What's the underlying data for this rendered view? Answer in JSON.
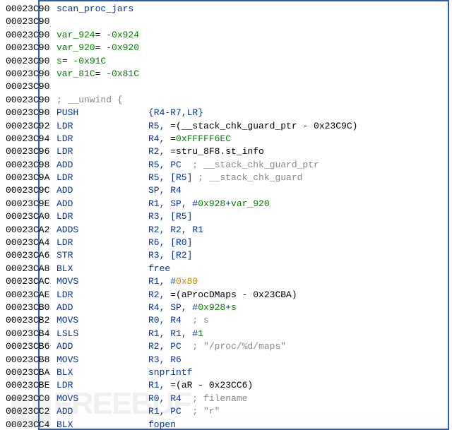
{
  "watermark": "FREEBUF",
  "lines": [
    {
      "addr": "00023C90",
      "segments": [
        {
          "cls": "op-blue col-op",
          "text": "scan_proc_jars"
        }
      ]
    },
    {
      "addr": "00023C90",
      "segments": []
    },
    {
      "addr": "00023C90",
      "segments": [
        {
          "cls": "num-green",
          "text": "var_924"
        },
        {
          "cls": "txt-black",
          "text": "= "
        },
        {
          "cls": "num-green",
          "text": "-0x924"
        }
      ]
    },
    {
      "addr": "00023C90",
      "segments": [
        {
          "cls": "num-green",
          "text": "var_920"
        },
        {
          "cls": "txt-black",
          "text": "= "
        },
        {
          "cls": "num-green",
          "text": "-0x920"
        }
      ]
    },
    {
      "addr": "00023C90",
      "segments": [
        {
          "cls": "num-green",
          "text": "s"
        },
        {
          "cls": "txt-black",
          "text": "= "
        },
        {
          "cls": "num-green",
          "text": "-0x91C"
        }
      ]
    },
    {
      "addr": "00023C90",
      "segments": [
        {
          "cls": "num-green",
          "text": "var_81C"
        },
        {
          "cls": "txt-black",
          "text": "= "
        },
        {
          "cls": "num-green",
          "text": "-0x81C"
        }
      ]
    },
    {
      "addr": "00023C90",
      "segments": []
    },
    {
      "addr": "00023C90",
      "segments": [
        {
          "cls": "txt-gray",
          "text": "; __unwind {"
        }
      ]
    },
    {
      "addr": "00023C90",
      "mnemonic": "PUSH",
      "mnemonicCls": "mn-blue",
      "segments": [
        {
          "cls": "op-blue",
          "text": "{R4-R7,LR}"
        }
      ]
    },
    {
      "addr": "00023C92",
      "mnemonic": "LDR",
      "mnemonicCls": "mn-blue",
      "segments": [
        {
          "cls": "op-blue",
          "text": "R5, "
        },
        {
          "cls": "txt-black",
          "text": "=(__stack_chk_guard_ptr - 0x23C9C)"
        }
      ]
    },
    {
      "addr": "00023C94",
      "mnemonic": "LDR",
      "mnemonicCls": "mn-blue",
      "segments": [
        {
          "cls": "op-blue",
          "text": "R4, "
        },
        {
          "cls": "txt-black",
          "text": "="
        },
        {
          "cls": "num-green",
          "text": "0xFFFFF6EC"
        }
      ]
    },
    {
      "addr": "00023C96",
      "mnemonic": "LDR",
      "mnemonicCls": "mn-blue",
      "segments": [
        {
          "cls": "op-blue",
          "text": "R2, "
        },
        {
          "cls": "txt-black",
          "text": "=stru_8F8.st_info"
        }
      ]
    },
    {
      "addr": "00023C98",
      "mnemonic": "ADD",
      "mnemonicCls": "mn-blue",
      "segments": [
        {
          "cls": "op-blue",
          "text": "R5, PC  "
        },
        {
          "cls": "txt-gray",
          "text": "; __stack_chk_guard_ptr"
        }
      ]
    },
    {
      "addr": "00023C9A",
      "mnemonic": "LDR",
      "mnemonicCls": "mn-blue",
      "segments": [
        {
          "cls": "op-blue",
          "text": "R5, [R5] "
        },
        {
          "cls": "txt-gray",
          "text": "; __stack_chk_guard"
        }
      ]
    },
    {
      "addr": "00023C9C",
      "mnemonic": "ADD",
      "mnemonicCls": "mn-blue",
      "segments": [
        {
          "cls": "op-blue",
          "text": "SP, R4"
        }
      ]
    },
    {
      "addr": "00023C9E",
      "mnemonic": "ADD",
      "mnemonicCls": "mn-blue",
      "segments": [
        {
          "cls": "op-blue",
          "text": "R1, SP, #"
        },
        {
          "cls": "num-green",
          "text": "0x928"
        },
        {
          "cls": "op-blue",
          "text": "+"
        },
        {
          "cls": "num-green",
          "text": "var_920"
        }
      ]
    },
    {
      "addr": "00023CA0",
      "mnemonic": "LDR",
      "mnemonicCls": "mn-blue",
      "segments": [
        {
          "cls": "op-blue",
          "text": "R3, [R5]"
        }
      ]
    },
    {
      "addr": "00023CA2",
      "mnemonic": "ADDS",
      "mnemonicCls": "mn-blue",
      "segments": [
        {
          "cls": "op-blue",
          "text": "R2, R2, R1"
        }
      ]
    },
    {
      "addr": "00023CA4",
      "mnemonic": "LDR",
      "mnemonicCls": "mn-blue",
      "segments": [
        {
          "cls": "op-blue",
          "text": "R6, [R0]"
        }
      ]
    },
    {
      "addr": "00023CA6",
      "mnemonic": "STR",
      "mnemonicCls": "mn-blue",
      "segments": [
        {
          "cls": "op-blue",
          "text": "R3, [R2]"
        }
      ]
    },
    {
      "addr": "00023CA8",
      "mnemonic": "BLX",
      "mnemonicCls": "mn-blue",
      "segments": [
        {
          "cls": "op-blue",
          "text": "free"
        }
      ]
    },
    {
      "addr": "00023CAC",
      "mnemonic": "MOVS",
      "mnemonicCls": "mn-blue",
      "segments": [
        {
          "cls": "op-blue",
          "text": "R1, #"
        },
        {
          "cls": "num-orange",
          "text": "0x80"
        }
      ]
    },
    {
      "addr": "00023CAE",
      "mnemonic": "LDR",
      "mnemonicCls": "mn-blue",
      "segments": [
        {
          "cls": "op-blue",
          "text": "R2, "
        },
        {
          "cls": "txt-black",
          "text": "=(aProcDMaps - 0x23CBA)"
        }
      ]
    },
    {
      "addr": "00023CB0",
      "mnemonic": "ADD",
      "mnemonicCls": "mn-blue",
      "segments": [
        {
          "cls": "op-blue",
          "text": "R4, SP, #"
        },
        {
          "cls": "num-green",
          "text": "0x928"
        },
        {
          "cls": "op-blue",
          "text": "+"
        },
        {
          "cls": "num-green",
          "text": "s"
        }
      ]
    },
    {
      "addr": "00023CB2",
      "mnemonic": "MOVS",
      "mnemonicCls": "mn-blue",
      "segments": [
        {
          "cls": "op-blue",
          "text": "R0, R4  "
        },
        {
          "cls": "txt-gray",
          "text": "; s"
        }
      ]
    },
    {
      "addr": "00023CB4",
      "mnemonic": "LSLS",
      "mnemonicCls": "mn-blue",
      "segments": [
        {
          "cls": "op-blue",
          "text": "R1, R1, #"
        },
        {
          "cls": "num-green",
          "text": "1"
        }
      ]
    },
    {
      "addr": "00023CB6",
      "mnemonic": "ADD",
      "mnemonicCls": "mn-blue",
      "segments": [
        {
          "cls": "op-blue",
          "text": "R2, PC  "
        },
        {
          "cls": "txt-gray",
          "text": "; \"/proc/%d/maps\""
        }
      ]
    },
    {
      "addr": "00023CB8",
      "mnemonic": "MOVS",
      "mnemonicCls": "mn-blue",
      "segments": [
        {
          "cls": "op-blue",
          "text": "R3, R6"
        }
      ]
    },
    {
      "addr": "00023CBA",
      "mnemonic": "BLX",
      "mnemonicCls": "mn-blue",
      "segments": [
        {
          "cls": "op-blue",
          "text": "snprintf"
        }
      ]
    },
    {
      "addr": "00023CBE",
      "mnemonic": "LDR",
      "mnemonicCls": "mn-blue",
      "segments": [
        {
          "cls": "op-blue",
          "text": "R1, "
        },
        {
          "cls": "txt-black",
          "text": "=(aR - 0x23CC6)"
        }
      ]
    },
    {
      "addr": "00023CC0",
      "mnemonic": "MOVS",
      "mnemonicCls": "mn-blue",
      "segments": [
        {
          "cls": "op-blue",
          "text": "R0, R4  "
        },
        {
          "cls": "txt-gray",
          "text": "; filename"
        }
      ]
    },
    {
      "addr": "00023CC2",
      "mnemonic": "ADD",
      "mnemonicCls": "mn-blue",
      "segments": [
        {
          "cls": "op-blue",
          "text": "R1, PC  "
        },
        {
          "cls": "txt-gray",
          "text": "; \"r\""
        }
      ]
    },
    {
      "addr": "00023CC4",
      "mnemonic": "BLX",
      "mnemonicCls": "mn-blue",
      "segments": [
        {
          "cls": "op-blue",
          "text": "fopen"
        }
      ]
    }
  ]
}
